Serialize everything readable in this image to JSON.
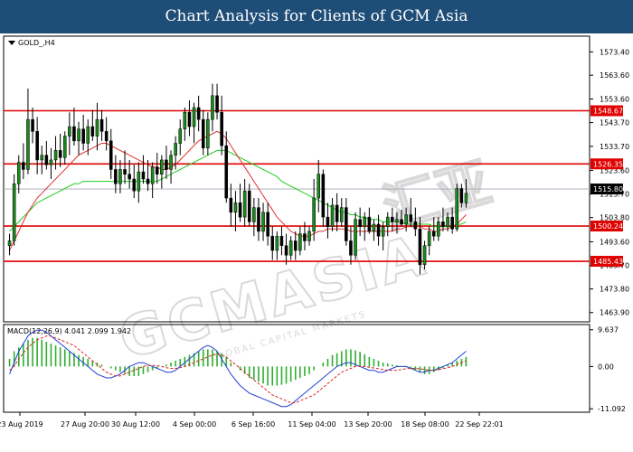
{
  "banner": {
    "title": "Chart Analysis for Clients of GCM Asia"
  },
  "watermark": {
    "brand": "GCMASIA",
    "sub": "GLOBAL CAPITAL MARKETS",
    "chinese": "汇亚"
  },
  "chart_data": [
    {
      "type": "candlestick",
      "symbol_label": "GOLD_,H4",
      "ylim": [
        1460,
        1580
      ],
      "yticks": [
        "1573.40",
        "1563.60",
        "1553.60",
        "1543.70",
        "1533.70",
        "1523.60",
        "1513.70",
        "1503.80",
        "1493.60",
        "1483.70",
        "1473.80",
        "1463.90"
      ],
      "xticks": [
        "23 Aug 2019",
        "27 Aug 20:00",
        "30 Aug 12:00",
        "4 Sep 00:00",
        "6 Sep 16:00",
        "11 Sep 04:00",
        "13 Sep 20:00",
        "18 Sep 08:00",
        "22 Sep 22:01"
      ],
      "levels": [
        {
          "value": 1548.67,
          "label": "1548.67"
        },
        {
          "value": 1526.35,
          "label": "1526.35"
        },
        {
          "value": 1500.24,
          "label": "1500.24"
        },
        {
          "value": 1485.43,
          "label": "1485.43"
        }
      ],
      "current_price": {
        "value": 1515.8,
        "label": "1515.80"
      },
      "candles": [
        [
          1492,
          1497,
          1488,
          1494
        ],
        [
          1494,
          1522,
          1492,
          1518
        ],
        [
          1518,
          1530,
          1514,
          1527
        ],
        [
          1527,
          1535,
          1520,
          1524
        ],
        [
          1524,
          1558,
          1522,
          1545
        ],
        [
          1545,
          1550,
          1535,
          1540
        ],
        [
          1540,
          1546,
          1522,
          1528
        ],
        [
          1528,
          1534,
          1522,
          1530
        ],
        [
          1530,
          1536,
          1524,
          1526
        ],
        [
          1526,
          1533,
          1520,
          1528
        ],
        [
          1528,
          1538,
          1524,
          1532
        ],
        [
          1532,
          1539,
          1525,
          1529
        ],
        [
          1529,
          1540,
          1526,
          1538
        ],
        [
          1538,
          1548,
          1530,
          1542
        ],
        [
          1542,
          1550,
          1534,
          1536
        ],
        [
          1536,
          1544,
          1530,
          1541
        ],
        [
          1541,
          1547,
          1532,
          1535
        ],
        [
          1535,
          1545,
          1530,
          1542
        ],
        [
          1542,
          1549,
          1536,
          1538
        ],
        [
          1538,
          1552,
          1532,
          1545
        ],
        [
          1545,
          1549,
          1536,
          1540
        ],
        [
          1540,
          1546,
          1532,
          1536
        ],
        [
          1536,
          1541,
          1520,
          1524
        ],
        [
          1524,
          1530,
          1514,
          1518
        ],
        [
          1518,
          1528,
          1514,
          1524
        ],
        [
          1524,
          1532,
          1518,
          1522
        ],
        [
          1522,
          1528,
          1516,
          1520
        ],
        [
          1520,
          1526,
          1512,
          1515
        ],
        [
          1515,
          1527,
          1510,
          1523
        ],
        [
          1523,
          1530,
          1518,
          1520
        ],
        [
          1520,
          1528,
          1515,
          1518
        ],
        [
          1518,
          1527,
          1512,
          1525
        ],
        [
          1525,
          1531,
          1518,
          1522
        ],
        [
          1522,
          1530,
          1516,
          1528
        ],
        [
          1528,
          1534,
          1520,
          1524
        ],
        [
          1524,
          1532,
          1518,
          1530
        ],
        [
          1530,
          1538,
          1524,
          1535
        ],
        [
          1535,
          1545,
          1530,
          1541
        ],
        [
          1541,
          1550,
          1536,
          1548
        ],
        [
          1548,
          1553,
          1538,
          1542
        ],
        [
          1542,
          1552,
          1535,
          1550
        ],
        [
          1550,
          1555,
          1540,
          1545
        ],
        [
          1545,
          1549,
          1530,
          1533
        ],
        [
          1533,
          1548,
          1530,
          1545
        ],
        [
          1545,
          1560,
          1540,
          1555
        ],
        [
          1555,
          1560,
          1545,
          1548
        ],
        [
          1548,
          1555,
          1530,
          1534
        ],
        [
          1534,
          1540,
          1510,
          1512
        ],
        [
          1512,
          1518,
          1500,
          1506
        ],
        [
          1506,
          1515,
          1498,
          1510
        ],
        [
          1510,
          1518,
          1502,
          1504
        ],
        [
          1504,
          1520,
          1500,
          1515
        ],
        [
          1515,
          1518,
          1500,
          1502
        ],
        [
          1502,
          1512,
          1496,
          1508
        ],
        [
          1508,
          1512,
          1494,
          1498
        ],
        [
          1498,
          1510,
          1494,
          1506
        ],
        [
          1506,
          1510,
          1492,
          1496
        ],
        [
          1496,
          1500,
          1486,
          1490
        ],
        [
          1490,
          1498,
          1486,
          1496
        ],
        [
          1496,
          1500,
          1488,
          1492
        ],
        [
          1492,
          1497,
          1484,
          1488
        ],
        [
          1488,
          1496,
          1486,
          1494
        ],
        [
          1494,
          1498,
          1486,
          1490
        ],
        [
          1490,
          1500,
          1488,
          1497
        ],
        [
          1497,
          1502,
          1490,
          1494
        ],
        [
          1494,
          1500,
          1492,
          1498
        ],
        [
          1498,
          1520,
          1494,
          1512
        ],
        [
          1512,
          1528,
          1506,
          1522
        ],
        [
          1522,
          1524,
          1500,
          1504
        ],
        [
          1504,
          1510,
          1495,
          1500
        ],
        [
          1500,
          1512,
          1498,
          1509
        ],
        [
          1509,
          1514,
          1498,
          1502
        ],
        [
          1502,
          1512,
          1500,
          1508
        ],
        [
          1508,
          1512,
          1492,
          1494
        ],
        [
          1494,
          1500,
          1484,
          1488
        ],
        [
          1488,
          1506,
          1486,
          1503
        ],
        [
          1503,
          1508,
          1496,
          1500
        ],
        [
          1500,
          1506,
          1494,
          1504
        ],
        [
          1504,
          1508,
          1497,
          1498
        ],
        [
          1498,
          1503,
          1494,
          1501
        ],
        [
          1501,
          1505,
          1492,
          1496
        ],
        [
          1496,
          1502,
          1490,
          1500
        ],
        [
          1500,
          1506,
          1496,
          1504
        ],
        [
          1504,
          1508,
          1498,
          1502
        ],
        [
          1502,
          1506,
          1497,
          1503
        ],
        [
          1503,
          1507,
          1500,
          1501
        ],
        [
          1501,
          1508,
          1498,
          1505
        ],
        [
          1505,
          1512,
          1500,
          1502
        ],
        [
          1502,
          1508,
          1496,
          1499
        ],
        [
          1499,
          1504,
          1480,
          1484
        ],
        [
          1484,
          1494,
          1482,
          1492
        ],
        [
          1492,
          1500,
          1488,
          1498
        ],
        [
          1498,
          1504,
          1494,
          1496
        ],
        [
          1496,
          1504,
          1494,
          1502
        ],
        [
          1502,
          1508,
          1498,
          1500
        ],
        [
          1500,
          1506,
          1498,
          1504
        ],
        [
          1504,
          1508,
          1497,
          1499
        ],
        [
          1499,
          1518,
          1498,
          1516
        ],
        [
          1516,
          1518,
          1508,
          1510
        ],
        [
          1510,
          1520,
          1508,
          1514
        ]
      ],
      "ma_red": [
        1490,
        1494,
        1498,
        1502,
        1506,
        1509,
        1512,
        1514,
        1516,
        1518,
        1520,
        1522,
        1524,
        1526,
        1528,
        1530,
        1531,
        1532,
        1533,
        1534,
        1535,
        1535,
        1534,
        1533,
        1532,
        1531,
        1530,
        1529,
        1528,
        1527,
        1526,
        1525,
        1525,
        1524,
        1524,
        1525,
        1526,
        1528,
        1530,
        1532,
        1534,
        1536,
        1537,
        1538,
        1539,
        1540,
        1539,
        1537,
        1534,
        1531,
        1528,
        1525,
        1522,
        1519,
        1516,
        1513,
        1510,
        1507,
        1504,
        1502,
        1500,
        1498,
        1497,
        1496,
        1496,
        1496,
        1497,
        1498,
        1498,
        1499,
        1499,
        1499,
        1499,
        1499,
        1498,
        1498,
        1498,
        1498,
        1498,
        1498,
        1498,
        1498,
        1498,
        1498,
        1499,
        1499,
        1500,
        1500,
        1500,
        1500,
        1499,
        1499,
        1498,
        1498,
        1499,
        1499,
        1500,
        1501,
        1503,
        1505
      ],
      "ma_green": [
        1498,
        1500,
        1502,
        1504,
        1506,
        1508,
        1510,
        1511,
        1512,
        1513,
        1514,
        1515,
        1516,
        1517,
        1518,
        1518,
        1519,
        1519,
        1519,
        1519,
        1519,
        1519,
        1519,
        1519,
        1519,
        1519,
        1519,
        1519,
        1519,
        1519,
        1519,
        1519,
        1519,
        1520,
        1521,
        1522,
        1523,
        1524,
        1525,
        1526,
        1527,
        1528,
        1529,
        1530,
        1531,
        1532,
        1532,
        1532,
        1531,
        1530,
        1529,
        1528,
        1527,
        1526,
        1525,
        1524,
        1523,
        1522,
        1521,
        1519,
        1518,
        1517,
        1516,
        1515,
        1514,
        1513,
        1512,
        1511,
        1510,
        1509,
        1508,
        1507,
        1506,
        1506,
        1505,
        1505,
        1504,
        1504,
        1503,
        1503,
        1503,
        1502,
        1502,
        1502,
        1502,
        1502,
        1501,
        1501,
        1501,
        1501,
        1501,
        1501,
        1500,
        1500,
        1500,
        1500,
        1500,
        1501,
        1501,
        1502
      ]
    },
    {
      "type": "macd",
      "label": "MACD(12,26,9) 4.041 2.099 1.942",
      "ylim": [
        -12,
        11
      ],
      "yticks": [
        "9.637",
        "0.00",
        "-11.092"
      ],
      "histogram": [
        2,
        4,
        5,
        6,
        7,
        7.5,
        7.5,
        7,
        6.5,
        6,
        5.5,
        5,
        4.5,
        4,
        3.5,
        3,
        2.5,
        2,
        1.5,
        1,
        0.5,
        0,
        -0.5,
        -1,
        -1.5,
        -2,
        -2.5,
        -2.5,
        -2.5,
        -2,
        -1.5,
        -1,
        -0.5,
        0,
        0.5,
        1,
        1.5,
        2,
        2.5,
        3,
        3.5,
        4,
        4.5,
        4.5,
        4.5,
        4,
        3.5,
        2.5,
        1,
        0,
        -1,
        -2,
        -3,
        -3.5,
        -4,
        -4.5,
        -5,
        -5,
        -5,
        -4.8,
        -4.5,
        -4,
        -3.5,
        -3,
        -2.5,
        -2,
        -1,
        0,
        1,
        2,
        3,
        3.5,
        4,
        4.5,
        4.5,
        4.2,
        3.8,
        3.2,
        2.5,
        2,
        1.5,
        1,
        0.8,
        0.5,
        0.3,
        0,
        -0.2,
        -0.5,
        -1,
        -1.5,
        -2,
        -2,
        -1.5,
        -1,
        -0.5,
        0.5,
        1,
        1.5,
        2,
        2.5
      ],
      "macd_line": [
        -2,
        1,
        4,
        6,
        8,
        9,
        9.5,
        9.5,
        9,
        8,
        7,
        6,
        5,
        4,
        3,
        2,
        1,
        0,
        -1,
        -2,
        -2.5,
        -3,
        -3,
        -2.5,
        -2,
        -1,
        0,
        0.5,
        1,
        1,
        0.5,
        0,
        -0.5,
        -1,
        -1.5,
        -1.5,
        -1,
        0,
        1,
        2,
        3,
        4,
        5,
        5.5,
        5,
        4,
        2,
        0,
        -2,
        -3.5,
        -5,
        -6,
        -7,
        -7.5,
        -8,
        -8.5,
        -9,
        -9.5,
        -10,
        -10.5,
        -10.5,
        -10,
        -9,
        -8,
        -7,
        -6,
        -5,
        -4,
        -3,
        -2,
        -1,
        0,
        0.5,
        1,
        1,
        0.5,
        0,
        -0.5,
        -1,
        -1,
        -1.5,
        -1.5,
        -1,
        -0.5,
        0,
        0,
        0,
        -0.5,
        -1,
        -1.5,
        -1.5,
        -1,
        -1,
        -0.5,
        0,
        0.5,
        1,
        2,
        3,
        4
      ],
      "signal_line": [
        -1,
        0,
        2,
        3.5,
        5,
        6,
        7,
        7.5,
        8,
        8,
        7.5,
        7,
        6.5,
        6,
        5.5,
        4.5,
        3.5,
        2.5,
        1.5,
        0.5,
        -0.5,
        -1.5,
        -2,
        -2.5,
        -2.5,
        -2,
        -1.5,
        -1,
        -0.5,
        0,
        0.3,
        0.3,
        0.2,
        0,
        -0.3,
        -0.5,
        -0.5,
        -0.3,
        0,
        0.5,
        1,
        1.5,
        2,
        2.5,
        3,
        3.2,
        3,
        2.5,
        1.5,
        0.5,
        -0.5,
        -1.5,
        -2.5,
        -3.5,
        -4.5,
        -5.5,
        -6.5,
        -7.5,
        -8,
        -8.5,
        -9,
        -9.5,
        -9.5,
        -9,
        -8.5,
        -8,
        -7.5,
        -6.5,
        -5.5,
        -4.5,
        -3.5,
        -2.5,
        -1.5,
        -1,
        -0.5,
        0,
        0,
        0,
        -0.2,
        -0.4,
        -0.6,
        -0.8,
        -1,
        -1,
        -1,
        -0.8,
        -0.6,
        -0.5,
        -0.5,
        -0.6,
        -0.8,
        -1,
        -1,
        -0.8,
        -0.6,
        -0.3,
        0,
        0.5,
        1,
        1.5
      ]
    }
  ]
}
